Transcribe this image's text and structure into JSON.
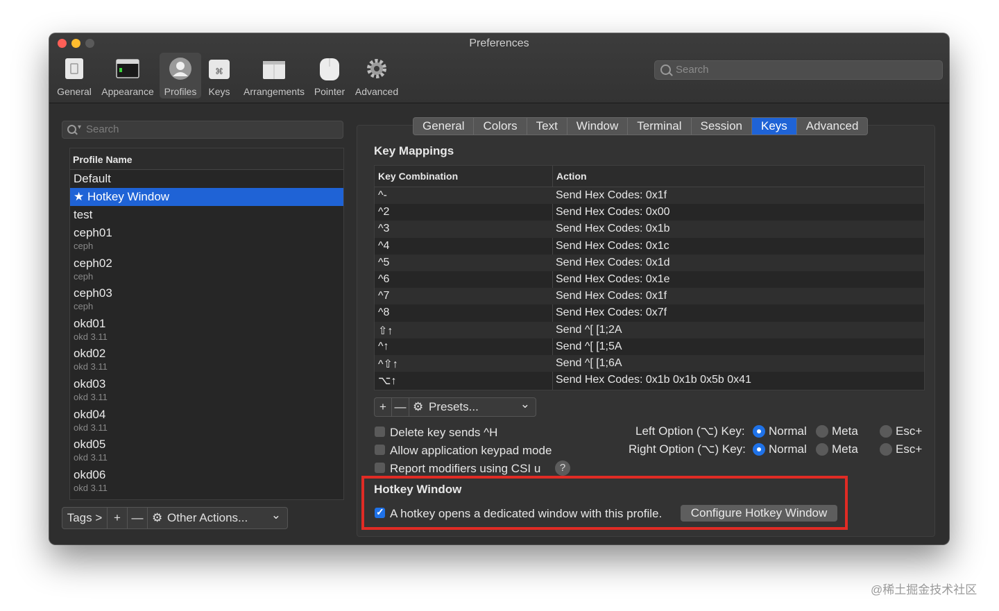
{
  "window": {
    "title": "Preferences"
  },
  "toolbar": {
    "items": [
      {
        "label": "General",
        "icon": "general-icon"
      },
      {
        "label": "Appearance",
        "icon": "appearance-icon"
      },
      {
        "label": "Profiles",
        "icon": "profiles-icon",
        "active": true
      },
      {
        "label": "Keys",
        "icon": "command-key-icon"
      },
      {
        "label": "Arrangements",
        "icon": "arrangements-icon"
      },
      {
        "label": "Pointer",
        "icon": "mouse-icon"
      },
      {
        "label": "Advanced",
        "icon": "gear-icon"
      }
    ],
    "search_placeholder": "Search"
  },
  "sidebar": {
    "search_placeholder": "Search",
    "header": "Profile Name",
    "profiles": [
      {
        "name": "Default",
        "tag": ""
      },
      {
        "name": "★ Hotkey Window",
        "tag": "",
        "selected": true
      },
      {
        "name": "test",
        "tag": ""
      },
      {
        "name": "ceph01",
        "tag": "ceph"
      },
      {
        "name": "ceph02",
        "tag": "ceph"
      },
      {
        "name": "ceph03",
        "tag": "ceph"
      },
      {
        "name": "okd01",
        "tag": "okd 3.11"
      },
      {
        "name": "okd02",
        "tag": "okd 3.11"
      },
      {
        "name": "okd03",
        "tag": "okd 3.11"
      },
      {
        "name": "okd04",
        "tag": "okd 3.11"
      },
      {
        "name": "okd05",
        "tag": "okd 3.11"
      },
      {
        "name": "okd06",
        "tag": "okd 3.11"
      }
    ],
    "bottom": {
      "tags": "Tags >",
      "add": "+",
      "remove": "—",
      "other_actions": "Other Actions...",
      "chevron": "⌄"
    }
  },
  "tabs": [
    "General",
    "Colors",
    "Text",
    "Window",
    "Terminal",
    "Session",
    "Keys",
    "Advanced"
  ],
  "active_tab": "Keys",
  "key_mappings": {
    "title": "Key Mappings",
    "col_key": "Key Combination",
    "col_action": "Action",
    "rows": [
      {
        "key": "^-",
        "action": "Send Hex Codes: 0x1f"
      },
      {
        "key": "^2",
        "action": "Send Hex Codes: 0x00"
      },
      {
        "key": "^3",
        "action": "Send Hex Codes: 0x1b"
      },
      {
        "key": "^4",
        "action": "Send Hex Codes: 0x1c"
      },
      {
        "key": "^5",
        "action": "Send Hex Codes: 0x1d"
      },
      {
        "key": "^6",
        "action": "Send Hex Codes: 0x1e"
      },
      {
        "key": "^7",
        "action": "Send Hex Codes: 0x1f"
      },
      {
        "key": "^8",
        "action": "Send Hex Codes: 0x7f"
      },
      {
        "key": "⇧↑",
        "action": "Send ^[ [1;2A"
      },
      {
        "key": "^↑",
        "action": "Send ^[ [1;5A"
      },
      {
        "key": "^⇧↑",
        "action": "Send ^[ [1;6A"
      },
      {
        "key": "⌥↑",
        "action": "Send Hex Codes: 0x1b 0x1b 0x5b 0x41"
      }
    ],
    "add": "+",
    "remove": "—",
    "presets": "Presets...",
    "chevron": "⌄"
  },
  "options": {
    "delete_sends_h": "Delete key sends ^H",
    "keypad_mode": "Allow application keypad mode",
    "csi_u": "Report modifiers using CSI u",
    "help": "?",
    "left_option_label": "Left Option (⌥) Key:",
    "right_option_label": "Right Option (⌥) Key:",
    "normal": "Normal",
    "meta": "Meta",
    "esc": "Esc+"
  },
  "hotkey": {
    "title": "Hotkey Window",
    "checkbox_label": "A hotkey opens a dedicated window with this profile.",
    "button": "Configure Hotkey Window",
    "checked": true
  },
  "watermark": "@稀土掘金技术社区",
  "colors": {
    "accent": "#1f63d6",
    "highlight_box": "#e02b25"
  }
}
